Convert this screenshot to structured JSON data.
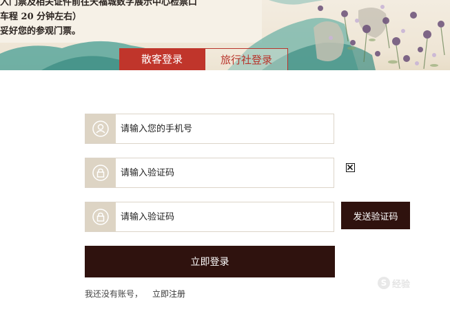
{
  "banner": {
    "notice_lines": [
      "入门票及相关证件前往天福城数字展示中心检票口",
      "车程 20 分钟左右）",
      "妥好您的参观门票。"
    ]
  },
  "tabs": [
    {
      "label": "散客登录",
      "active": true
    },
    {
      "label": "旅行社登录",
      "active": false
    }
  ],
  "form": {
    "phone": {
      "placeholder": "请输入您的手机号",
      "value": "",
      "icon": "user-icon"
    },
    "captcha": {
      "placeholder": "请输入验证码",
      "value": "",
      "icon": "lock-icon"
    },
    "sms_code": {
      "placeholder": "请输入验证码",
      "value": "",
      "icon": "lock-icon"
    },
    "captcha_image_icon": "broken-image-icon",
    "send_code_label": "发送验证码",
    "submit_label": "立即登录"
  },
  "register": {
    "prompt": "我还没有账号，",
    "link": "立即注册"
  },
  "watermark": {
    "text": "经验"
  },
  "colors": {
    "accent_red": "#c0352b",
    "dark_button": "#2f120e",
    "icon_box": "#ddd4c4"
  }
}
